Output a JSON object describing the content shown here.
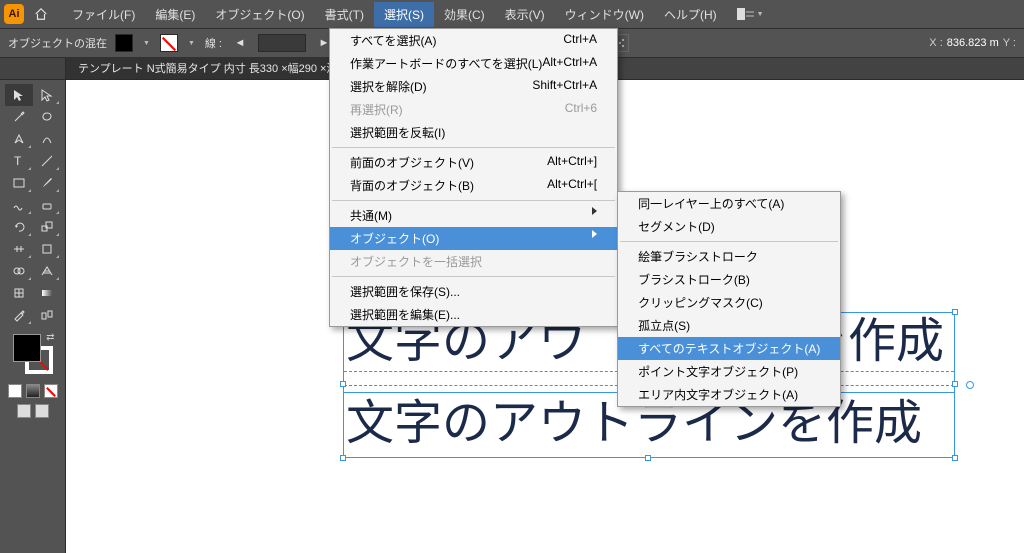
{
  "menubar": {
    "items": [
      {
        "label": "ファイル(F)"
      },
      {
        "label": "編集(E)"
      },
      {
        "label": "オブジェクト(O)"
      },
      {
        "label": "書式(T)"
      },
      {
        "label": "選択(S)",
        "open": true
      },
      {
        "label": "効果(C)"
      },
      {
        "label": "表示(V)"
      },
      {
        "label": "ウィンドウ(W)"
      },
      {
        "label": "ヘルプ(H)"
      }
    ]
  },
  "optionsbar": {
    "mixed_label": "オブジェクトの混在",
    "stroke_label": "線 :",
    "stroke_width": "",
    "coord_x_label": "X :",
    "coord_x_value": "836.823 m",
    "coord_y_label": "Y :"
  },
  "tab": {
    "title": "テンプレート N式簡易タイプ 内寸 長330 ×幅290 ×深150 B"
  },
  "artwork": {
    "text1": "文字のアウ",
    "text1_right": "を作成",
    "text2": "文字のアウトラインを作成"
  },
  "dropdown": {
    "items": [
      {
        "label": "すべてを選択(A)",
        "shortcut": "Ctrl+A"
      },
      {
        "label": "作業アートボードのすべてを選択(L)",
        "shortcut": "Alt+Ctrl+A"
      },
      {
        "label": "選択を解除(D)",
        "shortcut": "Shift+Ctrl+A"
      },
      {
        "label": "再選択(R)",
        "shortcut": "Ctrl+6",
        "disabled": true
      },
      {
        "label": "選択範囲を反転(I)"
      },
      {
        "sep": true
      },
      {
        "label": "前面のオブジェクト(V)",
        "shortcut": "Alt+Ctrl+]"
      },
      {
        "label": "背面のオブジェクト(B)",
        "shortcut": "Alt+Ctrl+["
      },
      {
        "sep": true
      },
      {
        "label": "共通(M)",
        "submenu": true
      },
      {
        "label": "オブジェクト(O)",
        "submenu": true,
        "hovered": true
      },
      {
        "label": "オブジェクトを一括選択",
        "disabled": true
      },
      {
        "sep": true
      },
      {
        "label": "選択範囲を保存(S)..."
      },
      {
        "label": "選択範囲を編集(E)..."
      }
    ]
  },
  "submenu": {
    "items": [
      {
        "label": "同一レイヤー上のすべて(A)"
      },
      {
        "label": "セグメント(D)"
      },
      {
        "sep": true
      },
      {
        "label": "絵筆ブラシストローク"
      },
      {
        "label": "ブラシストローク(B)"
      },
      {
        "label": "クリッピングマスク(C)"
      },
      {
        "label": "孤立点(S)"
      },
      {
        "label": "すべてのテキストオブジェクト(A)",
        "hovered": true
      },
      {
        "label": "ポイント文字オブジェクト(P)"
      },
      {
        "label": "エリア内文字オブジェクト(A)"
      }
    ]
  }
}
